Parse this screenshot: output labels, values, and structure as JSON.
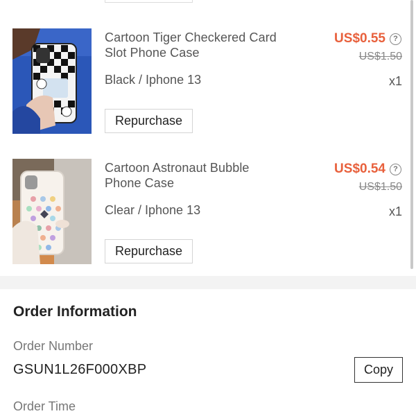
{
  "items": [
    {
      "title": "Cartoon Tiger Checkered Card Slot Phone Case",
      "variant": "Black / Iphone 13",
      "price": "US$0.55",
      "original_price": "US$1.50",
      "quantity": "x1",
      "repurchase_label": "Repurchase",
      "help_icon": "question-circle-icon"
    },
    {
      "title": "Cartoon Astronaut Bubble Phone Case",
      "variant": "Clear / Iphone 13",
      "price": "US$0.54",
      "original_price": "US$1.50",
      "quantity": "x1",
      "repurchase_label": "Repurchase",
      "help_icon": "question-circle-icon"
    }
  ],
  "order_information": {
    "title": "Order Information",
    "order_number_label": "Order Number",
    "order_number": "GSUN1L26F000XBP",
    "copy_label": "Copy",
    "order_time_label": "Order Time"
  },
  "colors": {
    "price": "#e8603c",
    "divider": "#f3f3f3"
  }
}
